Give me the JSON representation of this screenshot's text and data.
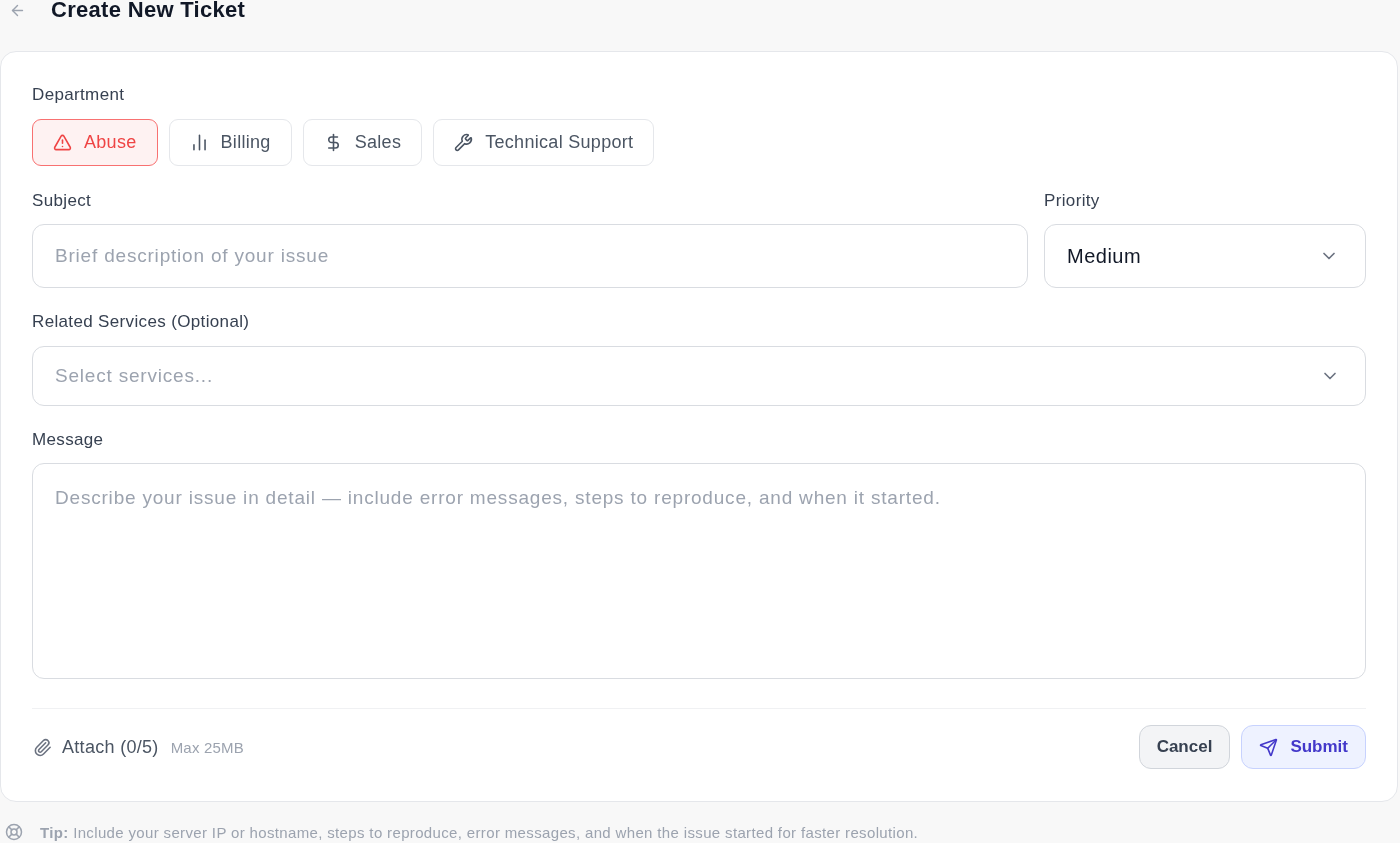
{
  "header": {
    "title": "Create New Ticket"
  },
  "department": {
    "label": "Department",
    "options": [
      {
        "label": "Abuse",
        "selected": true,
        "kind": "warning"
      },
      {
        "label": "Billing",
        "selected": false,
        "kind": "chart"
      },
      {
        "label": "Sales",
        "selected": false,
        "kind": "dollar"
      },
      {
        "label": "Technical Support",
        "selected": false,
        "kind": "wrench"
      }
    ]
  },
  "subject": {
    "label": "Subject",
    "placeholder": "Brief description of your issue"
  },
  "priority": {
    "label": "Priority",
    "value": "Medium"
  },
  "related_services": {
    "label": "Related Services (Optional)",
    "placeholder": "Select services..."
  },
  "message": {
    "label": "Message",
    "placeholder": "Describe your issue in detail — include error messages, steps to reproduce, and when it started."
  },
  "attachments": {
    "label": "Attach (0/5)",
    "hint": "Max 25MB"
  },
  "buttons": [
    {
      "label": "Cancel",
      "kind": "secondary"
    },
    {
      "label": "Submit",
      "kind": "primary"
    }
  ],
  "tip": {
    "text": "**Tip:** Include your server IP or hostname, steps to reproduce, error messages, and when the issue started for faster resolution."
  }
}
